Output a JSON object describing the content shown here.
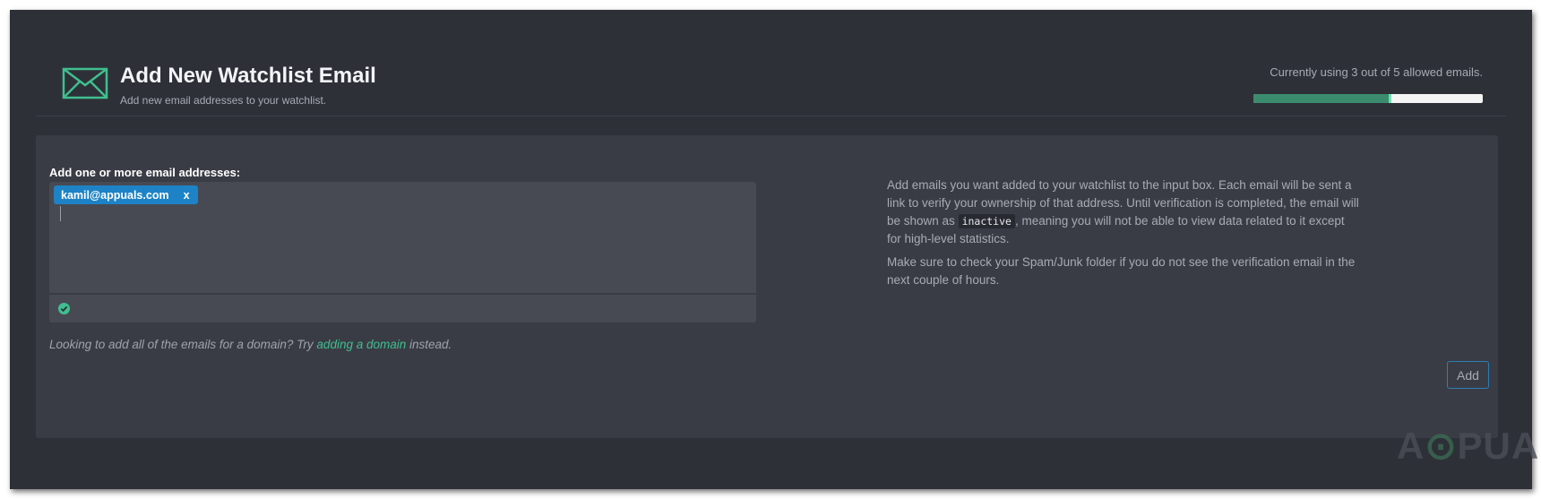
{
  "header": {
    "title": "Add New Watchlist Email",
    "subtitle": "Add new email addresses to your watchlist.",
    "usage_text": "Currently using 3 out of 5 allowed emails.",
    "usage_used": 3,
    "usage_allowed": 5,
    "icon": "envelope-icon"
  },
  "form": {
    "label": "Add one or more email addresses:",
    "chips": [
      {
        "text": "kamil@appuals.com",
        "remove_label": "x"
      }
    ],
    "status_icon": "check-circle-icon",
    "hint_prefix": "Looking to add all of the emails for a domain? Try ",
    "hint_link": "adding a domain",
    "hint_suffix": " instead.",
    "add_button": "Add"
  },
  "info": {
    "para1_before": "Add emails you want added to your watchlist to the input box. Each email will be sent a link to verify your ownership of that address. Until verification is completed, the email will be shown as ",
    "para1_code": "inactive",
    "para1_after": ", meaning you will not be able to view data related to it except for high-level statistics.",
    "para2": "Make sure to check your Spam/Junk folder if you do not see the verification email in the next couple of hours."
  },
  "watermark": "APPUALS",
  "colors": {
    "accent": "#3fbf8f",
    "chip": "#1d83c6",
    "background": "#2e3038",
    "panel": "#3a3c45"
  }
}
